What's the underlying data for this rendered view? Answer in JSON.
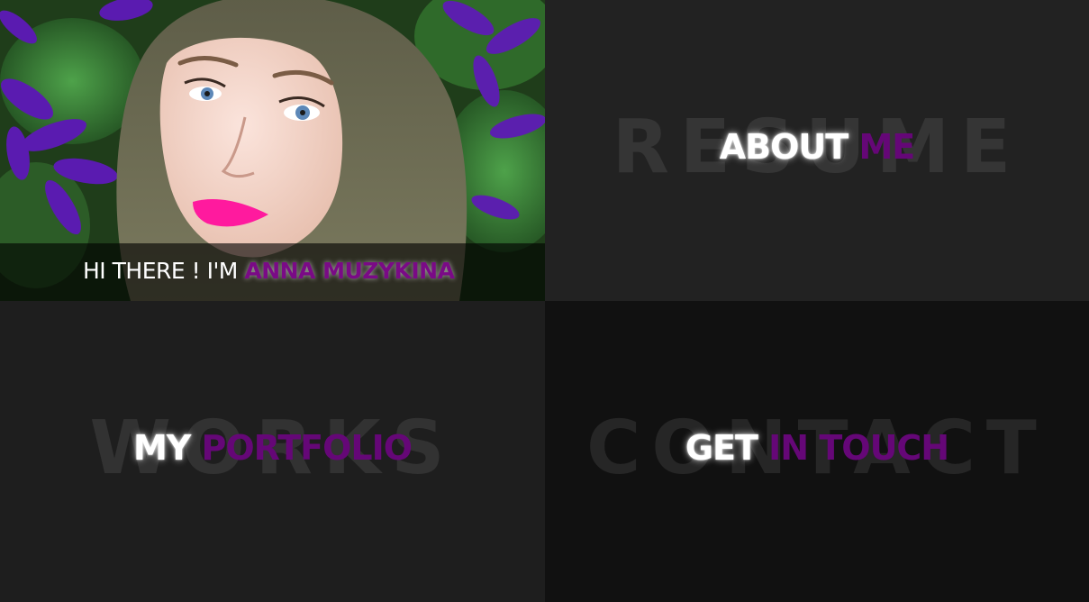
{
  "hero": {
    "greeting": "HI THERE ! I'M",
    "name": "ANNA MUZYKINA",
    "photo_alt": "Portrait of Anna Muzykina among purple clematis flowers"
  },
  "tiles": {
    "about": {
      "bg_word": "RESUME",
      "title_white": "ABOUT",
      "title_purple": "ME"
    },
    "portfolio": {
      "bg_word": "WORKS",
      "title_white": "MY",
      "title_purple": "PORTFOLIO"
    },
    "contact": {
      "bg_word": "CONTACT",
      "title_white": "GET",
      "title_purple": "IN TOUCH"
    }
  },
  "colors": {
    "accent_purple": "#650777",
    "tile_dark": "#222222",
    "tile_darker": "#111111",
    "lipstick": "#ff1a9e"
  }
}
